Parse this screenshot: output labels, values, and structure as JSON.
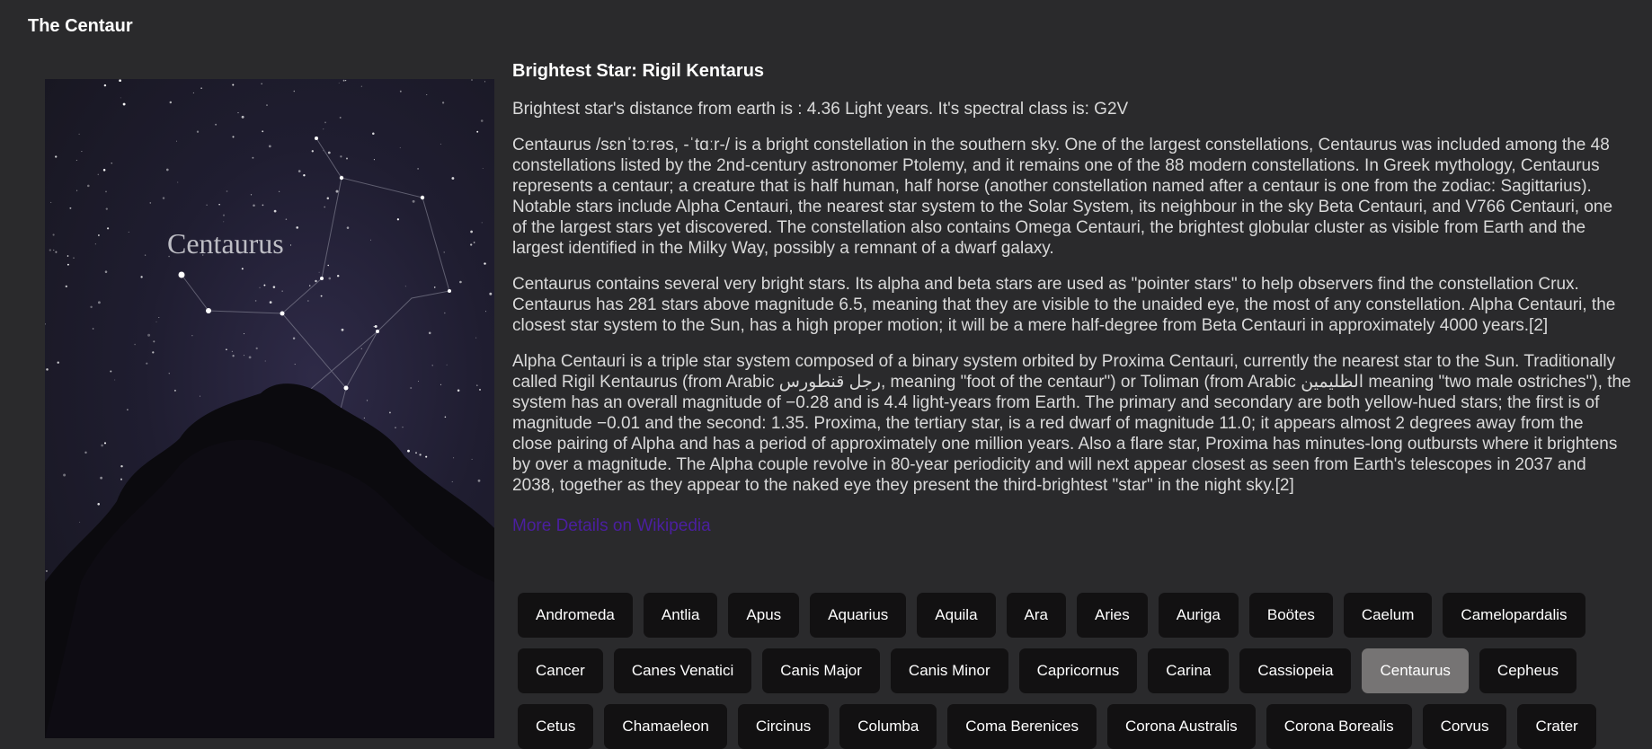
{
  "header": {
    "title": "The Centaur"
  },
  "image": {
    "label": "Centaurus"
  },
  "main": {
    "heading": "Brightest Star: Rigil Kentarus",
    "star_info": "Brightest star's distance from earth is : 4.36 Light years. It's spectral class is: G2V",
    "paragraphs": [
      "Centaurus /sɛnˈtɔːrəs, -ˈtɑːr-/ is a bright constellation in the southern sky. One of the largest constellations, Centaurus was included among the 48\nconstellations listed by the 2nd-century astronomer Ptolemy, and it remains one of the 88 modern constellations. In Greek mythology, Centaurus\nrepresents a centaur; a creature that is half human, half horse (another constellation named after a centaur is one from the zodiac: Sagittarius).\nNotable stars include Alpha Centauri, the nearest star system to the Solar System, its neighbour in the sky Beta Centauri, and V766 Centauri, one\nof the largest stars yet discovered. The constellation also contains Omega Centauri, the brightest globular cluster as visible from Earth and the\nlargest identified in the Milky Way, possibly a remnant of a dwarf galaxy.",
      "Centaurus contains several very bright stars. Its alpha and beta stars are used as \"pointer stars\" to help observers find the constellation Crux.\nCentaurus has 281 stars above magnitude 6.5, meaning that they are visible to the unaided eye, the most of any constellation. Alpha Centauri, the\nclosest star system to the Sun, has a high proper motion; it will be a mere half-degree from Beta Centauri in approximately 4000 years.[2]",
      "Alpha Centauri is a triple star system composed of a binary system orbited by Proxima Centauri, currently the nearest star to the Sun. Traditionally\ncalled Rigil Kentaurus (from Arabic رجل قنطورس, meaning \"foot of the centaur\") or Toliman (from Arabic الظليمين meaning \"two male ostriches\"), the\nsystem has an overall magnitude of −0.28 and is 4.4 light-years from Earth. The primary and secondary are both yellow-hued stars; the first is of\nmagnitude −0.01 and the second: 1.35. Proxima, the tertiary star, is a red dwarf of magnitude 11.0; it appears almost 2 degrees away from the\nclose pairing of Alpha and has a period of approximately one million years. Also a flare star, Proxima has minutes-long outbursts where it brightens\nby over a magnitude. The Alpha couple revolve in 80-year periodicity and will next appear closest as seen from Earth's telescopes in 2037 and\n2038, together as they appear to the naked eye they present the third-brightest \"star\" in the night sky.[2]"
    ],
    "link_label": "More Details on Wikipedia"
  },
  "constellations": [
    "Andromeda",
    "Antlia",
    "Apus",
    "Aquarius",
    "Aquila",
    "Ara",
    "Aries",
    "Auriga",
    "Boötes",
    "Caelum",
    "Camelopardalis",
    "Cancer",
    "Canes Venatici",
    "Canis Major",
    "Canis Minor",
    "Capricornus",
    "Carina",
    "Cassiopeia",
    "Centaurus",
    "Cepheus",
    "Cetus",
    "Chamaeleon",
    "Circinus",
    "Columba",
    "Coma Berenices",
    "Corona Australis",
    "Corona Borealis",
    "Corvus",
    "Crater"
  ],
  "selected": "Centaurus",
  "colors": {
    "background": "#2a2a2c",
    "chip": "#121112",
    "chip_active": "#767474",
    "link": "#4b1fa0"
  }
}
